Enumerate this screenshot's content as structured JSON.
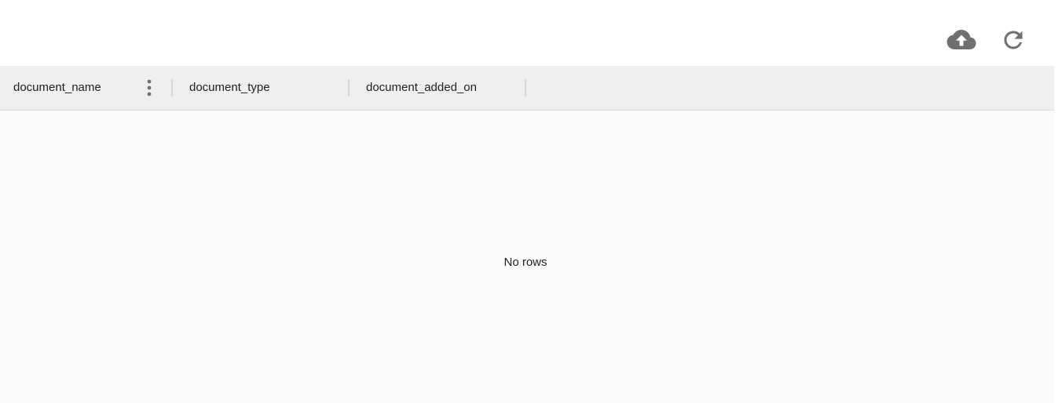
{
  "toolbar": {
    "upload_icon": "cloud-upload-icon",
    "refresh_icon": "refresh-icon",
    "icon_color": "#707070"
  },
  "grid": {
    "columns": [
      {
        "field": "document_name"
      },
      {
        "field": "document_type"
      },
      {
        "field": "document_added_on"
      }
    ],
    "column_menu_icon": "vertical-dots-icon",
    "empty_text": "No rows",
    "colors": {
      "header_background": "#efefef",
      "body_background": "#fbfbfb",
      "separator": "#d7d7d7"
    }
  }
}
